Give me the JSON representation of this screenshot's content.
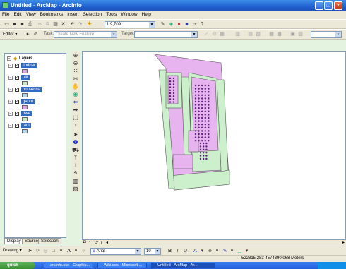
{
  "window": {
    "title": "Untitled - ArcMap - ArcInfo"
  },
  "menu": [
    "File",
    "Edit",
    "View",
    "Bookmarks",
    "Insert",
    "Selection",
    "Tools",
    "Window",
    "Help"
  ],
  "standard_toolbar": {
    "scale": "1:9,709"
  },
  "editor_toolbar": {
    "editor_label": "Editor ▾",
    "task_label": "Task:",
    "task_value": "Create New Feature",
    "target_label": "Target:"
  },
  "toc": {
    "root_label": "Layers",
    "layers": [
      {
        "name": "lindhar",
        "color": "#d9a6e0"
      },
      {
        "name": "ulit",
        "color": "#c8e6c8"
      },
      {
        "name": "pohaetha",
        "color": "#b0d8f0"
      },
      {
        "name": "gaure",
        "color": "#d9a6e0"
      },
      {
        "name": "dwe",
        "color": "#c8e6c8"
      },
      {
        "name": "tadi",
        "color": "#b0d8f0"
      }
    ],
    "tabs": [
      "Display",
      "Source",
      "Selection"
    ]
  },
  "drawing_toolbar": {
    "drawing_label": "Drawing ▾",
    "font": "Arial",
    "font_size": "10"
  },
  "status": {
    "coordinates": "522815,283  4574390,068 Meters"
  },
  "taskbar": {
    "start_label": "quick",
    "tasks": [
      "arcInfo.exe - Graphic...",
      "Wiki.doc - Microsoft ...",
      "Untitled - ArcMap - Ar..."
    ]
  },
  "colors": {
    "pink": "#e7b4ef",
    "green": "#ccf0cc",
    "selected": "#316ac5",
    "points": "#5a1f7a"
  }
}
